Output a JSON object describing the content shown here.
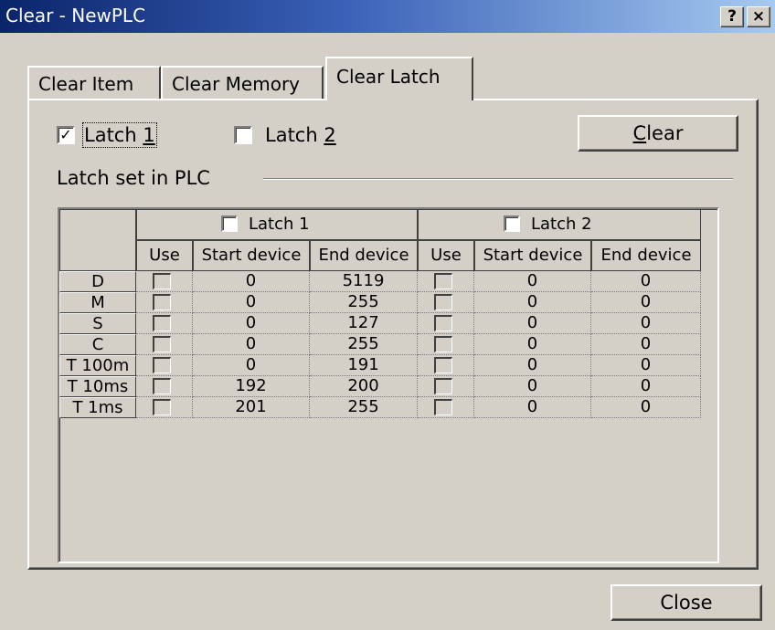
{
  "window": {
    "title": "Clear - NewPLC",
    "help_button": "?",
    "close_button": "×"
  },
  "tabs": [
    {
      "label": "Clear Item",
      "selected": false
    },
    {
      "label": "Clear Memory",
      "selected": false
    },
    {
      "label": "Clear Latch",
      "selected": true
    }
  ],
  "latch_options": {
    "latch1": {
      "text": "Latch ",
      "mnemonic": "1",
      "checked": true,
      "check_mark": "✓"
    },
    "latch2": {
      "text": "Latch ",
      "mnemonic": "2",
      "checked": false
    }
  },
  "clear_button": {
    "mnemonic": "C",
    "rest": "lear"
  },
  "group": {
    "label": "Latch set in  PLC"
  },
  "grid": {
    "groups": [
      "Latch 1",
      "Latch 2"
    ],
    "columns": [
      "Use",
      "Start device",
      "End device",
      "Use",
      "Start device",
      "End device"
    ],
    "rows": [
      {
        "device": "D",
        "l1_start": "0",
        "l1_end": "5119",
        "l2_start": "0",
        "l2_end": "0"
      },
      {
        "device": "M",
        "l1_start": "0",
        "l1_end": "255",
        "l2_start": "0",
        "l2_end": "0"
      },
      {
        "device": "S",
        "l1_start": "0",
        "l1_end": "127",
        "l2_start": "0",
        "l2_end": "0"
      },
      {
        "device": "C",
        "l1_start": "0",
        "l1_end": "255",
        "l2_start": "0",
        "l2_end": "0"
      },
      {
        "device": "T 100m",
        "l1_start": "0",
        "l1_end": "191",
        "l2_start": "0",
        "l2_end": "0"
      },
      {
        "device": "T 10ms",
        "l1_start": "192",
        "l1_end": "200",
        "l2_start": "0",
        "l2_end": "0"
      },
      {
        "device": "T 1ms",
        "l1_start": "201",
        "l1_end": "255",
        "l2_start": "0",
        "l2_end": "0"
      }
    ]
  },
  "close_button": {
    "label": "Close"
  }
}
